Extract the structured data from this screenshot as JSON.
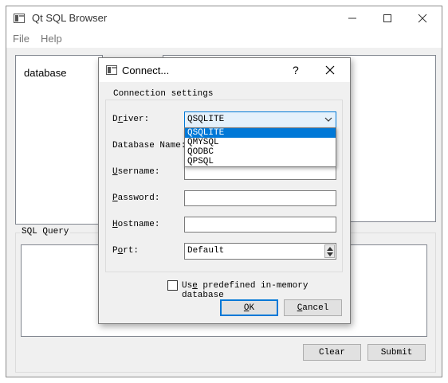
{
  "main_window": {
    "title": "Qt SQL Browser",
    "menu": [
      "File",
      "Help"
    ],
    "tree_item": "database",
    "sql_query_label": "SQL Query",
    "clear_label": "Clear",
    "submit_label": "Submit"
  },
  "dialog": {
    "title": "Connect...",
    "help": "?",
    "group_title": "Connection settings",
    "fields": {
      "driver": {
        "pre": "D",
        "acc": "r",
        "post": "iver:"
      },
      "dbname": {
        "label": "Database Name:"
      },
      "username": {
        "pre": "",
        "acc": "U",
        "post": "sername:"
      },
      "password": {
        "pre": "",
        "acc": "P",
        "post": "assword:"
      },
      "hostname": {
        "pre": "",
        "acc": "H",
        "post": "ostname:"
      },
      "port": {
        "pre": "P",
        "acc": "o",
        "post": "rt:"
      }
    },
    "driver_selected": "QSQLITE",
    "driver_options": [
      "QSQLITE",
      "QMYSQL",
      "QODBC",
      "QPSQL"
    ],
    "port_value": "Default",
    "checkbox": {
      "pre": "Us",
      "acc": "e",
      "post": " predefined in-memory database"
    },
    "ok": {
      "acc": "O",
      "post": "K"
    },
    "cancel": {
      "acc": "C",
      "post": "ancel"
    }
  },
  "colors": {
    "accent": "#0078d7",
    "window_bg": "#f0f0f0",
    "focus_border": "#0078d7"
  }
}
